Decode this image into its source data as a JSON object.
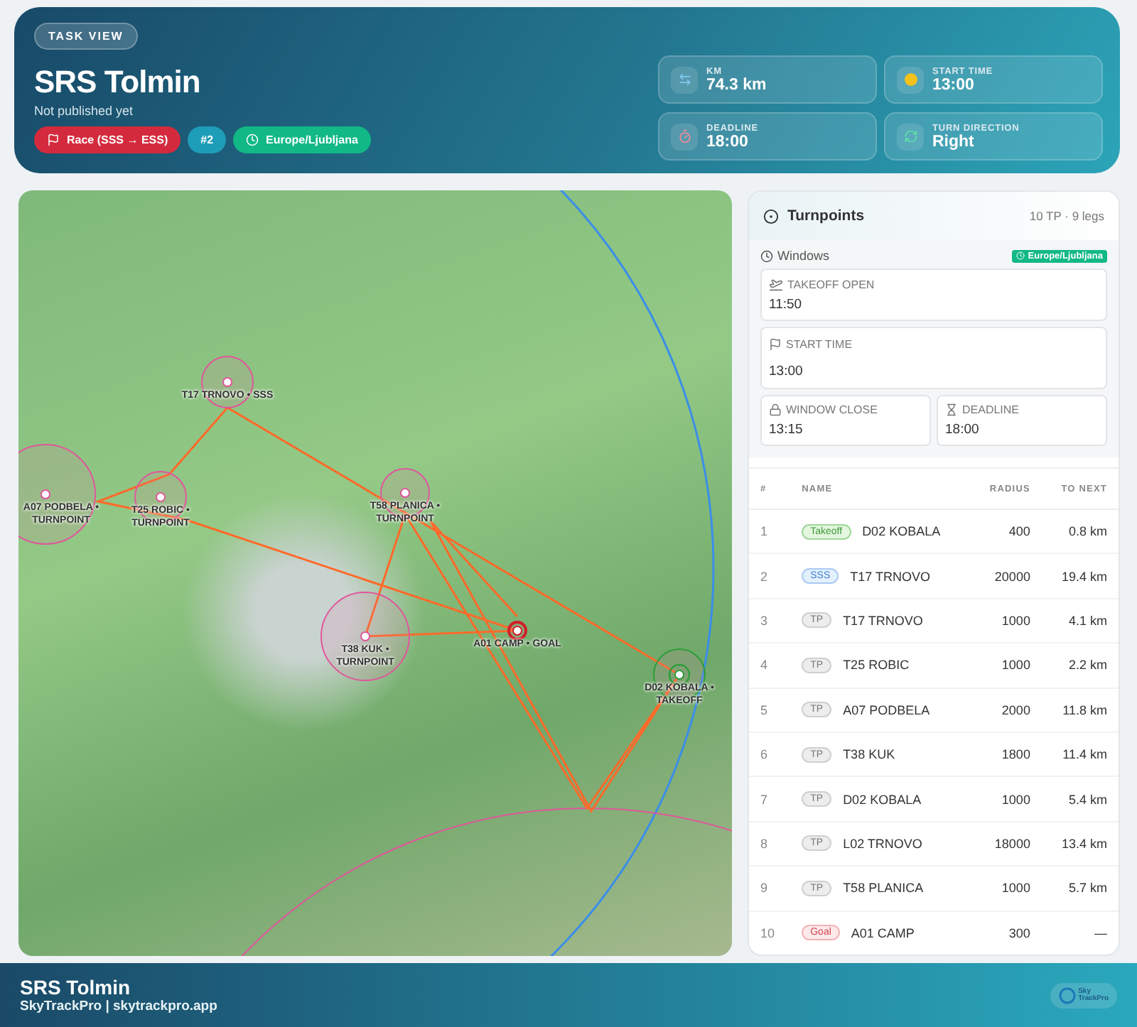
{
  "header": {
    "badge": "TASK VIEW",
    "title": "SRS Tolmin",
    "subtitle": "Not published yet",
    "tags": [
      {
        "kind": "race",
        "label": "Race (SSS → ESS)"
      },
      {
        "kind": "number",
        "label": "#2"
      },
      {
        "kind": "timezone",
        "label": "Europe/Ljubljana"
      }
    ],
    "stats": [
      {
        "kind": "distance",
        "label": "KM",
        "value": "74.3 km"
      },
      {
        "kind": "start",
        "label": "START TIME",
        "value": "13:00"
      },
      {
        "kind": "deadline",
        "label": "DEADLINE",
        "value": "18:00"
      },
      {
        "kind": "turn",
        "label": "TURN DIRECTION",
        "value": "Right"
      }
    ]
  },
  "map": {
    "markers": [
      {
        "kind": "sss",
        "label": "T17 TRNOVO • SSS"
      },
      {
        "kind": "turnpoint",
        "label": "A07 PODBELA • TURNPOINT"
      },
      {
        "kind": "turnpoint",
        "label": "T25 ROBIC • TURNPOINT"
      },
      {
        "kind": "turnpoint",
        "label": "T58 PLANICA • TURNPOINT"
      },
      {
        "kind": "turnpoint",
        "label": "T38 KUK • TURNPOINT"
      },
      {
        "kind": "goal",
        "label": "A01 CAMP • GOAL"
      },
      {
        "kind": "takeoff",
        "label": "D02 KOBALA • TAKEOFF"
      }
    ]
  },
  "turnpoints": {
    "title": "Turnpoints",
    "summary": "10 TP · 9 legs",
    "windows": {
      "title": "Windows",
      "timezone": "Europe/Ljubljana",
      "items": [
        {
          "kind": "takeoff",
          "label": "TAKEOFF OPEN",
          "value": "11:50"
        },
        {
          "kind": "start",
          "label": "START TIME",
          "value": "13:00"
        },
        {
          "kind": "close",
          "label": "WINDOW CLOSE",
          "value": "13:15"
        },
        {
          "kind": "deadline",
          "label": "DEADLINE",
          "value": "18:00"
        }
      ]
    },
    "columns": [
      "#",
      "NAME",
      "RADIUS",
      "TO NEXT"
    ],
    "rows": [
      {
        "number": "1",
        "type": {
          "kind": "takeoff",
          "label": "Takeoff"
        },
        "name": "D02 KOBALA",
        "radius": "400",
        "to_next": "0.8 km"
      },
      {
        "number": "2",
        "type": {
          "kind": "sss",
          "label": "SSS"
        },
        "name": "T17 TRNOVO",
        "radius": "20000",
        "to_next": "19.4 km"
      },
      {
        "number": "3",
        "type": {
          "kind": "tp",
          "label": "TP"
        },
        "name": "T17 TRNOVO",
        "radius": "1000",
        "to_next": "4.1 km"
      },
      {
        "number": "4",
        "type": {
          "kind": "tp",
          "label": "TP"
        },
        "name": "T25 ROBIC",
        "radius": "1000",
        "to_next": "2.2 km"
      },
      {
        "number": "5",
        "type": {
          "kind": "tp",
          "label": "TP"
        },
        "name": "A07 PODBELA",
        "radius": "2000",
        "to_next": "11.8 km"
      },
      {
        "number": "6",
        "type": {
          "kind": "tp",
          "label": "TP"
        },
        "name": "T38 KUK",
        "radius": "1800",
        "to_next": "11.4 km"
      },
      {
        "number": "7",
        "type": {
          "kind": "tp",
          "label": "TP"
        },
        "name": "D02 KOBALA",
        "radius": "1000",
        "to_next": "5.4 km"
      },
      {
        "number": "8",
        "type": {
          "kind": "tp",
          "label": "TP"
        },
        "name": "L02 TRNOVO",
        "radius": "18000",
        "to_next": "13.4 km"
      },
      {
        "number": "9",
        "type": {
          "kind": "tp",
          "label": "TP"
        },
        "name": "T58 PLANICA",
        "radius": "1000",
        "to_next": "5.7 km"
      },
      {
        "number": "10",
        "type": {
          "kind": "goal",
          "label": "Goal"
        },
        "name": "A01 CAMP",
        "radius": "300",
        "to_next": "—"
      }
    ]
  },
  "footer": {
    "title": "SRS Tolmin",
    "subtitle": "SkyTrackPro | skytrackpro.app",
    "logo_lines": [
      "Sky",
      "TrackPro"
    ]
  }
}
